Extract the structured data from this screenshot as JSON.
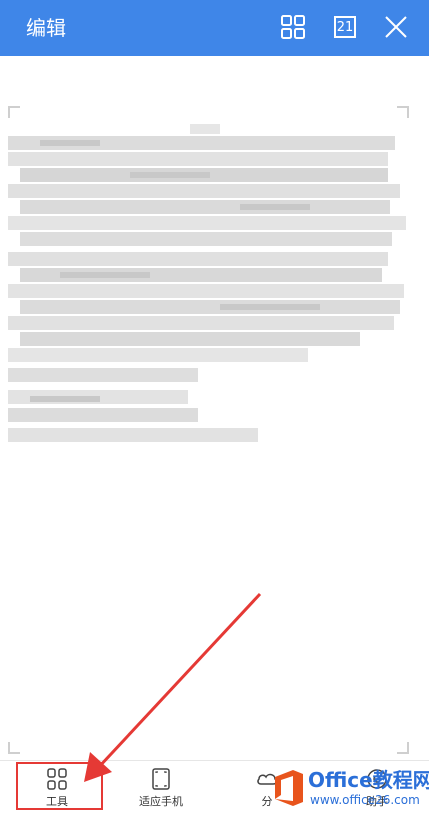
{
  "header": {
    "title": "编辑",
    "page_badge": "21"
  },
  "icons": {
    "grid": "grid-view-icon",
    "page": "page-number-icon",
    "close": "close-icon"
  },
  "toolbar": {
    "items": [
      {
        "label": "工具",
        "icon": "tools-grid-icon"
      },
      {
        "label": "适应手机",
        "icon": "fit-phone-icon"
      },
      {
        "label": "分",
        "icon": "share-icon"
      },
      {
        "label": "助手",
        "icon": "assistant-icon"
      }
    ]
  },
  "watermark": {
    "brand": "Office教程网",
    "url": "www.office26.com"
  },
  "colors": {
    "header_bg": "#3f86e8",
    "highlight": "#e53935",
    "watermark": "#2b6fd8"
  }
}
